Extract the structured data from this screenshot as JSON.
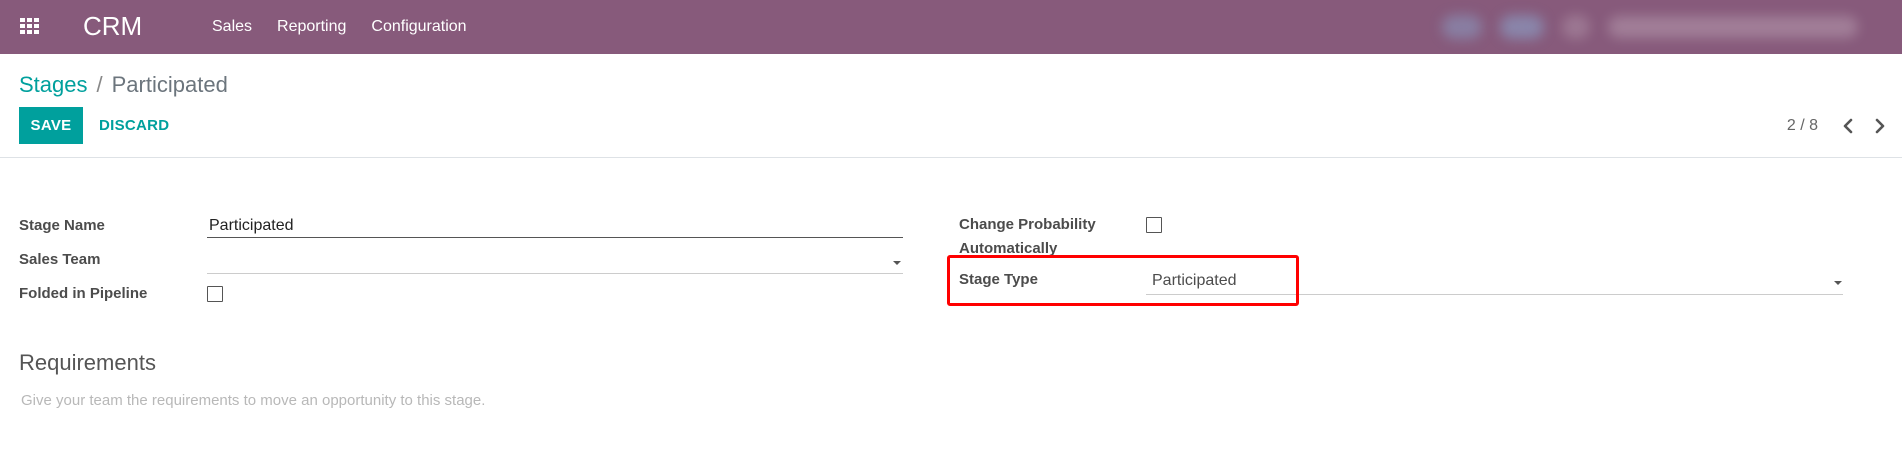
{
  "navbar": {
    "brand": "CRM",
    "menu": [
      "Sales",
      "Reporting",
      "Configuration"
    ],
    "color": "#875a7b"
  },
  "control_panel": {
    "breadcrumb": {
      "parent": "Stages",
      "separator": "/",
      "current": "Participated"
    },
    "save_label": "SAVE",
    "discard_label": "DISCARD",
    "pager": "2 / 8",
    "accent": "#00a09d"
  },
  "form": {
    "stage_name": {
      "label": "Stage Name",
      "value": "Participated"
    },
    "sales_team": {
      "label": "Sales Team",
      "value": ""
    },
    "folded": {
      "label": "Folded in Pipeline",
      "checked": false
    },
    "change_probability": {
      "label_line1": "Change Probability",
      "label_line2": "Automatically",
      "checked": false
    },
    "stage_type": {
      "label": "Stage Type",
      "value": "Participated"
    },
    "requirements": {
      "title": "Requirements",
      "placeholder": "Give your team the requirements to move an opportunity to this stage."
    }
  },
  "icons": [
    "apps-grid-icon",
    "chevron-left-icon",
    "chevron-right-icon",
    "caret-down-icon"
  ],
  "highlight_color": "#ff0000"
}
